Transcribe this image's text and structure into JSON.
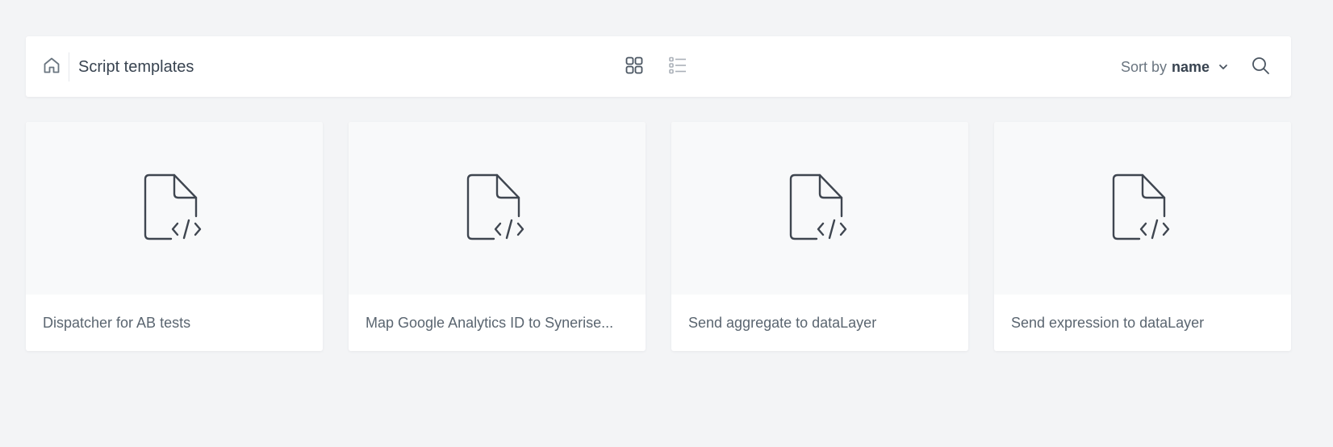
{
  "header": {
    "title": "Script templates",
    "home_icon": "home-icon",
    "view_modes": [
      {
        "icon": "grid-view-icon",
        "active": true
      },
      {
        "icon": "list-view-icon",
        "active": false
      }
    ],
    "sort": {
      "label": "Sort by",
      "value": "name",
      "icon": "chevron-down-icon"
    },
    "search_icon": "search-icon"
  },
  "cards": [
    {
      "title": "Dispatcher for AB tests",
      "icon": "code-file-icon"
    },
    {
      "title": "Map Google Analytics ID to Synerise...",
      "icon": "code-file-icon"
    },
    {
      "title": "Send aggregate to dataLayer",
      "icon": "code-file-icon"
    },
    {
      "title": "Send expression to dataLayer",
      "icon": "code-file-icon"
    }
  ],
  "colors": {
    "background": "#f3f4f6",
    "surface": "#ffffff",
    "preview": "#f8f9fa",
    "text": "#384350",
    "muted": "#6a7580",
    "icon_inactive": "#aab0b8"
  }
}
